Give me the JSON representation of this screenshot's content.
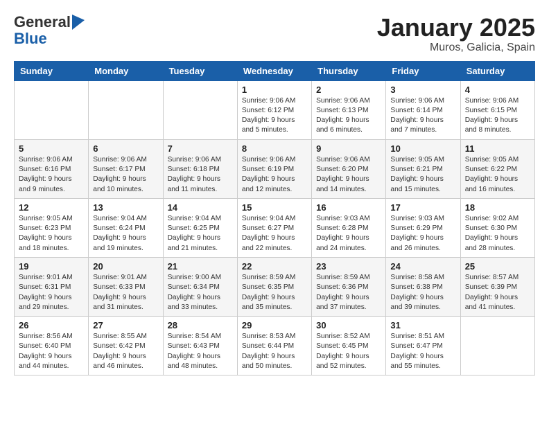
{
  "header": {
    "logo_general": "General",
    "logo_blue": "Blue",
    "month_title": "January 2025",
    "location": "Muros, Galicia, Spain"
  },
  "days_of_week": [
    "Sunday",
    "Monday",
    "Tuesday",
    "Wednesday",
    "Thursday",
    "Friday",
    "Saturday"
  ],
  "weeks": [
    [
      {
        "day": "",
        "info": ""
      },
      {
        "day": "",
        "info": ""
      },
      {
        "day": "",
        "info": ""
      },
      {
        "day": "1",
        "info": "Sunrise: 9:06 AM\nSunset: 6:12 PM\nDaylight: 9 hours\nand 5 minutes."
      },
      {
        "day": "2",
        "info": "Sunrise: 9:06 AM\nSunset: 6:13 PM\nDaylight: 9 hours\nand 6 minutes."
      },
      {
        "day": "3",
        "info": "Sunrise: 9:06 AM\nSunset: 6:14 PM\nDaylight: 9 hours\nand 7 minutes."
      },
      {
        "day": "4",
        "info": "Sunrise: 9:06 AM\nSunset: 6:15 PM\nDaylight: 9 hours\nand 8 minutes."
      }
    ],
    [
      {
        "day": "5",
        "info": "Sunrise: 9:06 AM\nSunset: 6:16 PM\nDaylight: 9 hours\nand 9 minutes."
      },
      {
        "day": "6",
        "info": "Sunrise: 9:06 AM\nSunset: 6:17 PM\nDaylight: 9 hours\nand 10 minutes."
      },
      {
        "day": "7",
        "info": "Sunrise: 9:06 AM\nSunset: 6:18 PM\nDaylight: 9 hours\nand 11 minutes."
      },
      {
        "day": "8",
        "info": "Sunrise: 9:06 AM\nSunset: 6:19 PM\nDaylight: 9 hours\nand 12 minutes."
      },
      {
        "day": "9",
        "info": "Sunrise: 9:06 AM\nSunset: 6:20 PM\nDaylight: 9 hours\nand 14 minutes."
      },
      {
        "day": "10",
        "info": "Sunrise: 9:05 AM\nSunset: 6:21 PM\nDaylight: 9 hours\nand 15 minutes."
      },
      {
        "day": "11",
        "info": "Sunrise: 9:05 AM\nSunset: 6:22 PM\nDaylight: 9 hours\nand 16 minutes."
      }
    ],
    [
      {
        "day": "12",
        "info": "Sunrise: 9:05 AM\nSunset: 6:23 PM\nDaylight: 9 hours\nand 18 minutes."
      },
      {
        "day": "13",
        "info": "Sunrise: 9:04 AM\nSunset: 6:24 PM\nDaylight: 9 hours\nand 19 minutes."
      },
      {
        "day": "14",
        "info": "Sunrise: 9:04 AM\nSunset: 6:25 PM\nDaylight: 9 hours\nand 21 minutes."
      },
      {
        "day": "15",
        "info": "Sunrise: 9:04 AM\nSunset: 6:27 PM\nDaylight: 9 hours\nand 22 minutes."
      },
      {
        "day": "16",
        "info": "Sunrise: 9:03 AM\nSunset: 6:28 PM\nDaylight: 9 hours\nand 24 minutes."
      },
      {
        "day": "17",
        "info": "Sunrise: 9:03 AM\nSunset: 6:29 PM\nDaylight: 9 hours\nand 26 minutes."
      },
      {
        "day": "18",
        "info": "Sunrise: 9:02 AM\nSunset: 6:30 PM\nDaylight: 9 hours\nand 28 minutes."
      }
    ],
    [
      {
        "day": "19",
        "info": "Sunrise: 9:01 AM\nSunset: 6:31 PM\nDaylight: 9 hours\nand 29 minutes."
      },
      {
        "day": "20",
        "info": "Sunrise: 9:01 AM\nSunset: 6:33 PM\nDaylight: 9 hours\nand 31 minutes."
      },
      {
        "day": "21",
        "info": "Sunrise: 9:00 AM\nSunset: 6:34 PM\nDaylight: 9 hours\nand 33 minutes."
      },
      {
        "day": "22",
        "info": "Sunrise: 8:59 AM\nSunset: 6:35 PM\nDaylight: 9 hours\nand 35 minutes."
      },
      {
        "day": "23",
        "info": "Sunrise: 8:59 AM\nSunset: 6:36 PM\nDaylight: 9 hours\nand 37 minutes."
      },
      {
        "day": "24",
        "info": "Sunrise: 8:58 AM\nSunset: 6:38 PM\nDaylight: 9 hours\nand 39 minutes."
      },
      {
        "day": "25",
        "info": "Sunrise: 8:57 AM\nSunset: 6:39 PM\nDaylight: 9 hours\nand 41 minutes."
      }
    ],
    [
      {
        "day": "26",
        "info": "Sunrise: 8:56 AM\nSunset: 6:40 PM\nDaylight: 9 hours\nand 44 minutes."
      },
      {
        "day": "27",
        "info": "Sunrise: 8:55 AM\nSunset: 6:42 PM\nDaylight: 9 hours\nand 46 minutes."
      },
      {
        "day": "28",
        "info": "Sunrise: 8:54 AM\nSunset: 6:43 PM\nDaylight: 9 hours\nand 48 minutes."
      },
      {
        "day": "29",
        "info": "Sunrise: 8:53 AM\nSunset: 6:44 PM\nDaylight: 9 hours\nand 50 minutes."
      },
      {
        "day": "30",
        "info": "Sunrise: 8:52 AM\nSunset: 6:45 PM\nDaylight: 9 hours\nand 52 minutes."
      },
      {
        "day": "31",
        "info": "Sunrise: 8:51 AM\nSunset: 6:47 PM\nDaylight: 9 hours\nand 55 minutes."
      },
      {
        "day": "",
        "info": ""
      }
    ]
  ]
}
